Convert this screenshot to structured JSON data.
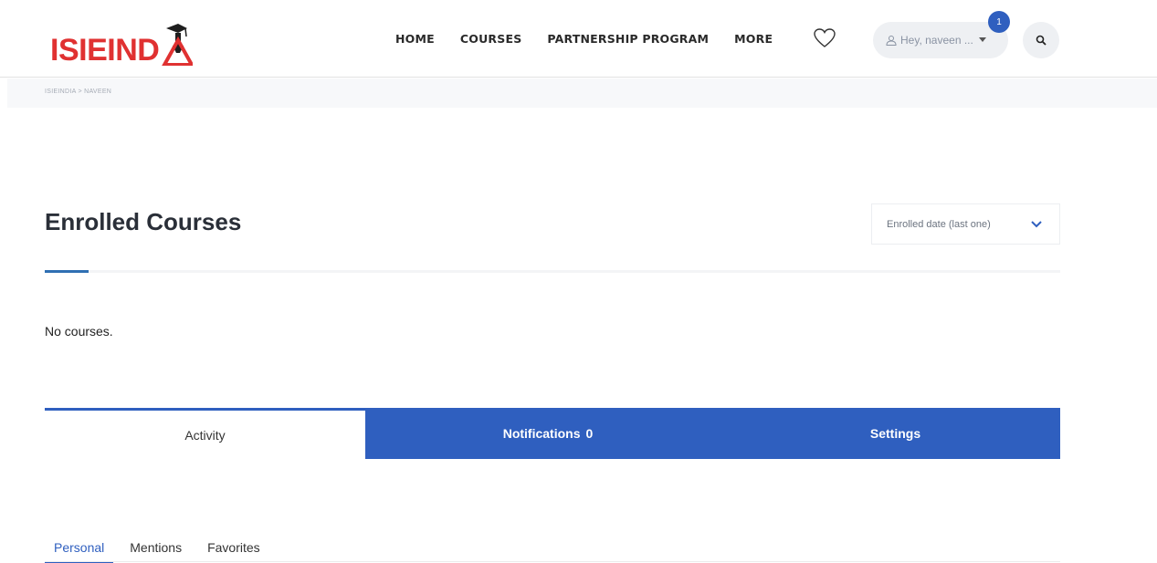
{
  "brand": {
    "logo_text": "ISIEIND",
    "logo_suffix": "A",
    "logo_color": "#e03131"
  },
  "nav": {
    "items": [
      {
        "label": "HOME"
      },
      {
        "label": "COURSES"
      },
      {
        "label": "PARTNERSHIP PROGRAM"
      },
      {
        "label": "MORE"
      }
    ]
  },
  "header": {
    "wishlist_icon": "heart-icon",
    "user_greeting": "Hey, naveen ...",
    "notification_badge": "1",
    "search_icon": "search-icon"
  },
  "breadcrumb": "ISIEINDIA > NAVEEN",
  "enrolled": {
    "title": "Enrolled Courses",
    "sort_selected": "Enrolled date (last one)",
    "empty_message": "No courses."
  },
  "tabs": {
    "activity": "Activity",
    "notifications_label": "Notifications",
    "notifications_count": "0",
    "settings": "Settings"
  },
  "subtabs": {
    "items": [
      {
        "label": "Personal"
      },
      {
        "label": "Mentions"
      },
      {
        "label": "Favorites"
      }
    ]
  },
  "colors": {
    "accent_blue": "#2f5fbf",
    "brand_red": "#e03131"
  }
}
